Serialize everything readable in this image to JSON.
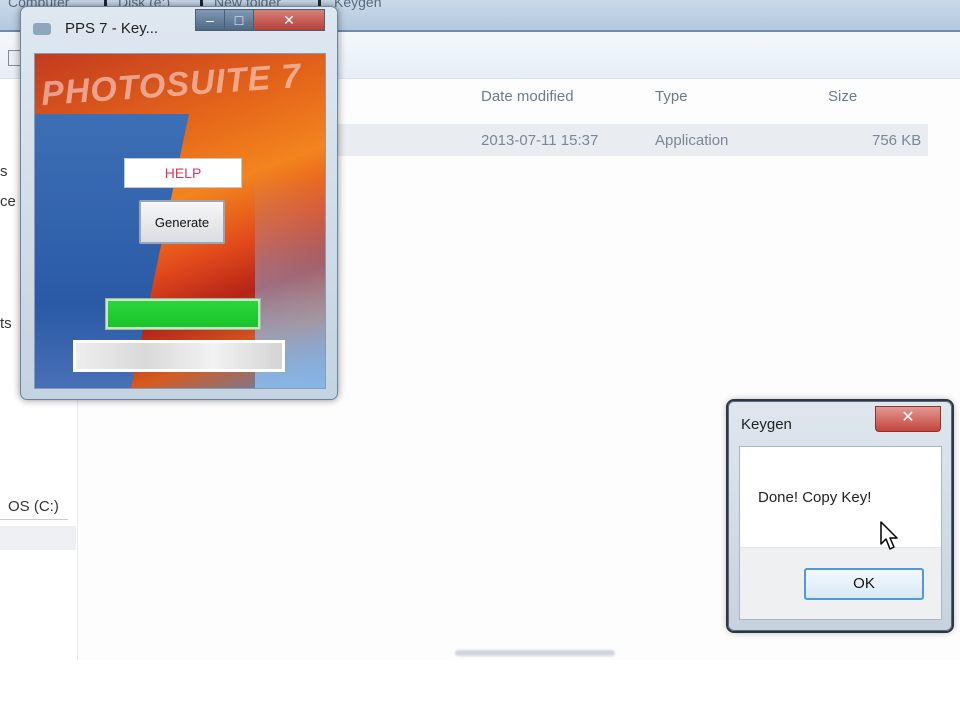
{
  "explorer": {
    "breadcrumbs": [
      "Computer",
      "Disk (e:)",
      "New folder",
      "Keygen"
    ],
    "columns": {
      "date": "Date modified",
      "type": "Type",
      "size": "Size"
    },
    "file": {
      "date": "2013-07-11 15:37",
      "type": "Application",
      "size": "756 KB"
    },
    "nav_fragments": [
      "s",
      "ce",
      "ts"
    ],
    "drive_label": "OS (C:)"
  },
  "keygen_window": {
    "title": "PPS 7 - Key...",
    "min_label": "–",
    "max_label": "□",
    "close_label": "✕",
    "logo": "PHOTOSUITE 7",
    "help_label": "HELP",
    "generate_label": "Generate",
    "progress": 1.0,
    "progress_color": "#19c42a",
    "key_value": ""
  },
  "message_box": {
    "title": "Keygen",
    "close_label": "✕",
    "message": "Done! Copy Key!",
    "ok_label": "OK"
  }
}
